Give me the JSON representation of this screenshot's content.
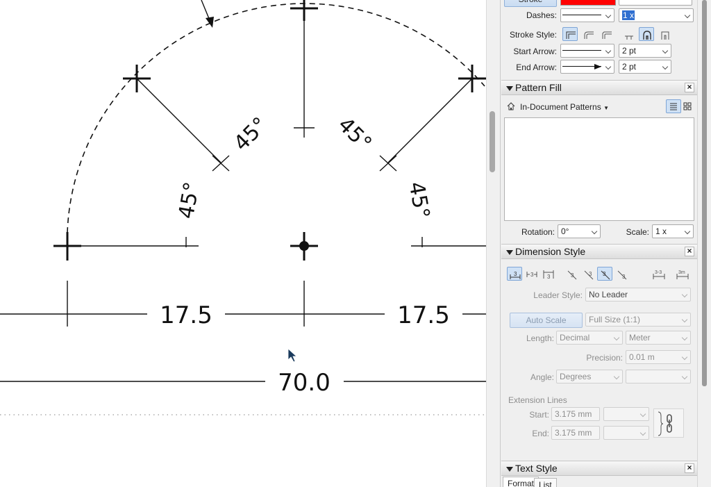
{
  "drawing": {
    "angle_labels": [
      "45°",
      "45°",
      "45°",
      "45°"
    ],
    "dim_left": "17.5",
    "dim_right": "17.5",
    "dim_overall": "70.0"
  },
  "stroke_section": {
    "stroke_button": "Stroke",
    "dashes_label": "Dashes:",
    "dash_scale": "1 x",
    "stroke_style_label": "Stroke Style:",
    "start_arrow_label": "Start Arrow:",
    "start_arrow_size": "2 pt",
    "end_arrow_label": "End Arrow:",
    "end_arrow_size": "2 pt",
    "stroke_color": "#ff0000"
  },
  "pattern_fill": {
    "title": "Pattern Fill",
    "source": "In-Document Patterns",
    "rotation_label": "Rotation:",
    "rotation_value": "0°",
    "scale_label": "Scale:",
    "scale_value": "1 x"
  },
  "dimension_style": {
    "title": "Dimension Style",
    "leader_style_label": "Leader Style:",
    "leader_style_value": "No Leader",
    "auto_scale_button": "Auto Scale",
    "scale_value": "Full Size (1:1)",
    "length_label": "Length:",
    "length_format": "Decimal",
    "length_unit": "Meter",
    "precision_label": "Precision:",
    "precision_value": "0.01 m",
    "angle_label": "Angle:",
    "angle_format": "Degrees",
    "extension_lines_label": "Extension Lines",
    "start_label": "Start:",
    "start_value": "3.175 mm",
    "end_label": "End:",
    "end_value": "3.175 mm"
  },
  "text_style": {
    "title": "Text Style",
    "tab_format": "Format",
    "tab_list": "List"
  }
}
